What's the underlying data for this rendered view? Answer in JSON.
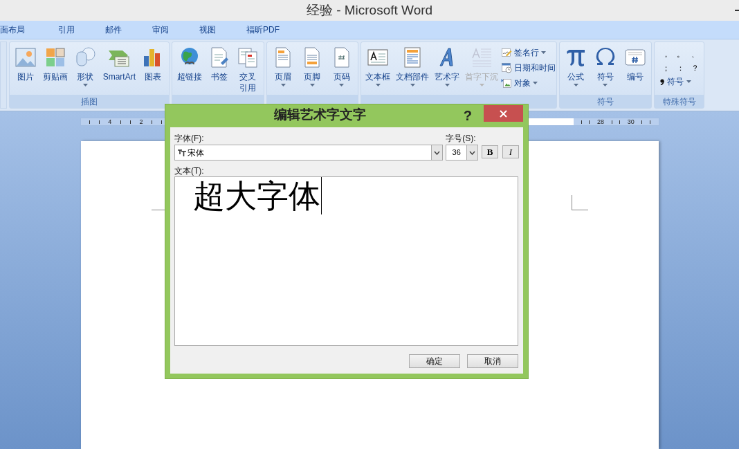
{
  "window": {
    "title": "经验 - Microsoft Word"
  },
  "ribbon_tabs": [
    {
      "label": "面布局",
      "selected": false
    },
    {
      "label": "引用",
      "selected": false
    },
    {
      "label": "邮件",
      "selected": false
    },
    {
      "label": "审阅",
      "selected": false
    },
    {
      "label": "视图",
      "selected": false
    },
    {
      "label": "福昕PDF",
      "selected": false
    }
  ],
  "ribbon_groups": [
    {
      "label": "插图",
      "items": [
        {
          "kind": "large",
          "label": "图片",
          "caret": false,
          "disabled": false
        },
        {
          "kind": "large",
          "label": "剪贴画",
          "caret": false,
          "disabled": false
        },
        {
          "kind": "large",
          "label": "形状",
          "caret": true,
          "disabled": false
        },
        {
          "kind": "large",
          "label": "SmartArt",
          "caret": false,
          "disabled": false
        },
        {
          "kind": "large",
          "label": "图表",
          "caret": false,
          "disabled": false
        }
      ]
    },
    {
      "items": [
        {
          "kind": "large",
          "label": "超链接",
          "caret": false,
          "disabled": false
        },
        {
          "kind": "large",
          "label": "书签",
          "caret": false,
          "disabled": false
        },
        {
          "kind": "large",
          "label": "交叉引用",
          "caret": false,
          "disabled": false
        }
      ]
    },
    {
      "items": [
        {
          "kind": "large",
          "label": "页眉",
          "caret": true,
          "disabled": false
        },
        {
          "kind": "large",
          "label": "页脚",
          "caret": true,
          "disabled": false
        },
        {
          "kind": "large",
          "label": "页码",
          "caret": true,
          "disabled": false
        }
      ]
    },
    {
      "items": [
        {
          "kind": "large",
          "label": "文本框",
          "caret": true,
          "disabled": false
        },
        {
          "kind": "large",
          "label": "文档部件",
          "caret": true,
          "disabled": false
        },
        {
          "kind": "large",
          "label": "艺术字",
          "caret": true,
          "disabled": false
        },
        {
          "kind": "large",
          "label": "首字下沉",
          "caret": true,
          "disabled": true
        },
        {
          "kind": "small",
          "label": "签名行",
          "caret": true,
          "disabled": false
        },
        {
          "kind": "small",
          "label": "日期和时间",
          "caret": false,
          "disabled": false
        },
        {
          "kind": "small",
          "label": "对象",
          "caret": true,
          "disabled": false
        }
      ]
    },
    {
      "label": "符号",
      "items": [
        {
          "kind": "large",
          "label": "公式",
          "caret": true,
          "disabled": false
        },
        {
          "kind": "large",
          "label": "符号",
          "caret": true,
          "disabled": false
        },
        {
          "kind": "large",
          "label": "编号",
          "caret": false,
          "disabled": false
        }
      ]
    },
    {
      "label": "特殊符号",
      "items": [
        {
          "kind": "symbols",
          "symbols": [
            "，",
            "。",
            "、",
            "；",
            "：",
            "？"
          ],
          "label": "符号",
          "caret": true
        }
      ]
    }
  ],
  "ruler": {
    "left_labels": [
      "4",
      "2"
    ],
    "right_labels": [
      "28",
      "30"
    ]
  },
  "dialog": {
    "title": "编辑艺术字文字",
    "help": "?",
    "font_label": "字体(F):",
    "font_value": "宋体",
    "size_label": "字号(S):",
    "size_value": "36",
    "bold_button": "B",
    "italic_button": "I",
    "text_label": "文本(T):",
    "text_value": "超大字体",
    "buttons": [
      "确定",
      "取消"
    ]
  }
}
